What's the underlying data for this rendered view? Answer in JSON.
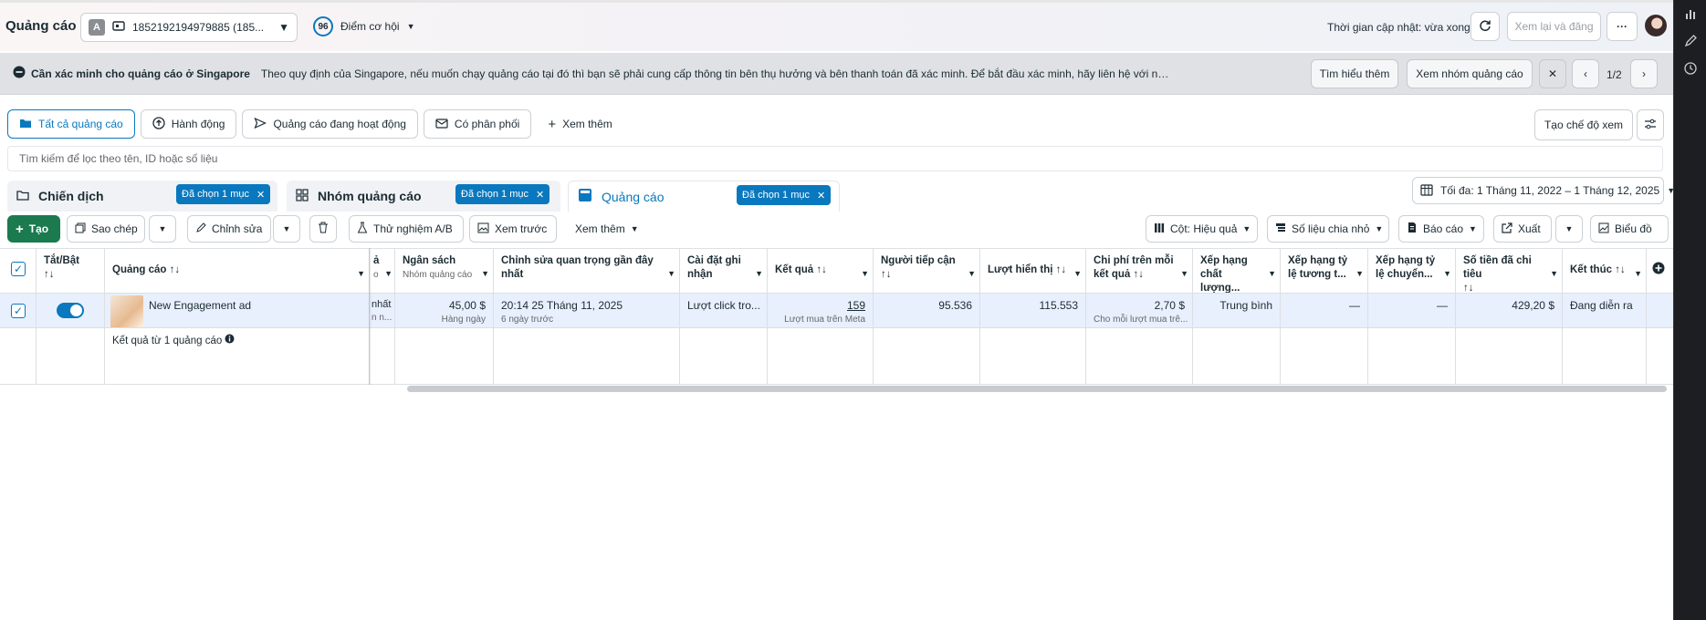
{
  "header": {
    "title": "Quảng cáo",
    "account_badge": "A",
    "account_text": "1852192194979885 (185...",
    "opportunity_score": "96",
    "opportunity_label": "Điểm cơ hội",
    "update_time": "Thời gian cập nhật: vừa xong",
    "review_publish": "Xem lại và đăng",
    "more": "···"
  },
  "banner": {
    "title": "Cần xác minh cho quảng cáo ở Singapore",
    "body": "Theo quy định của Singapore, nếu muốn chạy quảng cáo tại đó thì bạn sẽ phải cung cấp thông tin bên thụ hưởng và bên thanh toán đã xác minh. Để bắt đầu xác minh, hãy liên hệ với người nắm toàn quyền kiểm soát tài khoản quản...",
    "learn_more": "Tìm hiểu thêm",
    "view_adsets": "Xem nhóm quảng cáo",
    "pager": "1/2"
  },
  "filters": {
    "all_ads": "Tất cả quảng cáo",
    "actions": "Hành động",
    "active_ads": "Quảng cáo đang hoạt động",
    "has_delivery": "Có phân phối",
    "see_more": "Xem thêm",
    "create_view": "Tạo chế độ xem"
  },
  "search": {
    "placeholder": "Tìm kiếm để lọc theo tên, ID hoặc số liệu"
  },
  "levels": {
    "campaign": "Chiến dịch",
    "adset": "Nhóm quảng cáo",
    "ad": "Quảng cáo",
    "chip": "Đã chọn 1 mục"
  },
  "date_range": "Tối đa: 1 Tháng 11, 2022 – 1 Tháng 12, 2025",
  "toolbar": {
    "create": "Tạo",
    "duplicate": "Sao chép",
    "edit": "Chỉnh sửa",
    "ab_test": "Thử nghiệm A/B",
    "preview": "Xem trước",
    "more": "Xem thêm",
    "columns": "Cột: Hiệu quả",
    "breakdown": "Số liệu chia nhỏ",
    "reports": "Báo cáo",
    "export": "Xuất",
    "charts": "Biểu đồ"
  },
  "table": {
    "headers": {
      "onoff": "Tắt/Bật",
      "ad": "Quảng cáo",
      "hidden_partial": "ả",
      "hidden_sub": "o",
      "budget": "Ngân sách",
      "budget_sub": "Nhóm quảng cáo",
      "last_edit": "Chỉnh sửa quan trọng gần đây nhất",
      "attribution": "Cài đặt ghi nhận",
      "results": "Kết quả",
      "reach": "Người tiếp cận",
      "impressions": "Lượt hiển thị",
      "cost_per_result": "Chi phí trên mỗi kết quả",
      "quality_rank": "Xếp hạng chất lượng...",
      "engagement_rank": "Xếp hạng tỷ lệ tương t...",
      "conversion_rank": "Xếp hạng tỷ lệ chuyển...",
      "amount_spent": "Số tiền đã chi tiêu",
      "ends": "Kết thúc"
    },
    "row": {
      "name": "New Engagement ad",
      "hidden_a": "nhất",
      "hidden_b": "n n...",
      "budget": "45,00 $",
      "budget_sub": "Hàng ngày",
      "last_edit": "20:14 25 Tháng 11, 2025",
      "last_edit_sub": "6 ngày trước",
      "attribution": "Lượt click tro...",
      "results": "159",
      "results_sub": "Lượt mua trên Meta",
      "reach": "95.536",
      "impressions": "115.553",
      "cost_per_result": "2,70 $",
      "cost_sub": "Cho mỗi lượt mua trê...",
      "quality_rank": "Trung bình",
      "engagement_rank": "—",
      "conversion_rank": "—",
      "amount_spent": "429,20 $",
      "ends": "Đang diễn ra"
    },
    "summary": "Kết quả từ 1 quảng cáo"
  },
  "colors": {
    "accent": "#0a78be",
    "create_green": "#1b7a4e",
    "selected_row": "#e8f0fd"
  }
}
